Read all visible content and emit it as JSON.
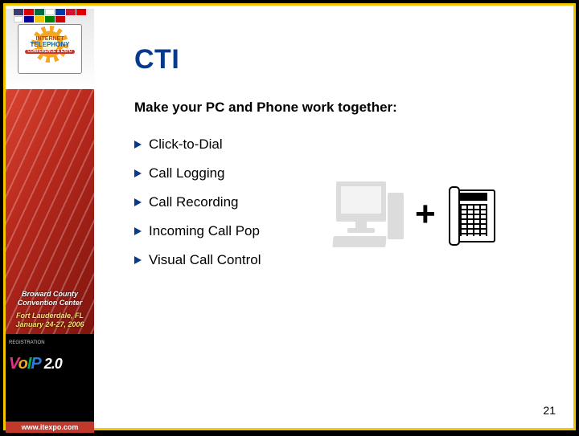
{
  "title": "CTI",
  "subtitle": "Make your PC and Phone work together:",
  "features": [
    "Click-to-Dial",
    "Call Logging",
    "Call Recording",
    "Incoming Call Pop",
    "Visual Call Control"
  ],
  "illustration": {
    "left": "pc",
    "operator": "+",
    "right": "phone"
  },
  "page_number": "21",
  "sidebar": {
    "logo": {
      "line1": "Fort Lauderdale",
      "line2": "INTERNET",
      "line3": "TELEPHONY",
      "pill": "CONFERENCE & EXPO"
    },
    "venue": "Broward County Convention Center",
    "location": "Fort Lauderdale, FL",
    "dates": "January 24-27, 2006",
    "brand_v": "V",
    "brand_o": "o",
    "brand_i": "I",
    "brand_p": "P",
    "brand_rest": " 2.0",
    "registration": "REGISTRATION",
    "url": "www.itexpo.com"
  },
  "colors": {
    "accent": "#083a8c",
    "frame": "#f2c500",
    "sidebar_red": "#b7281c"
  }
}
